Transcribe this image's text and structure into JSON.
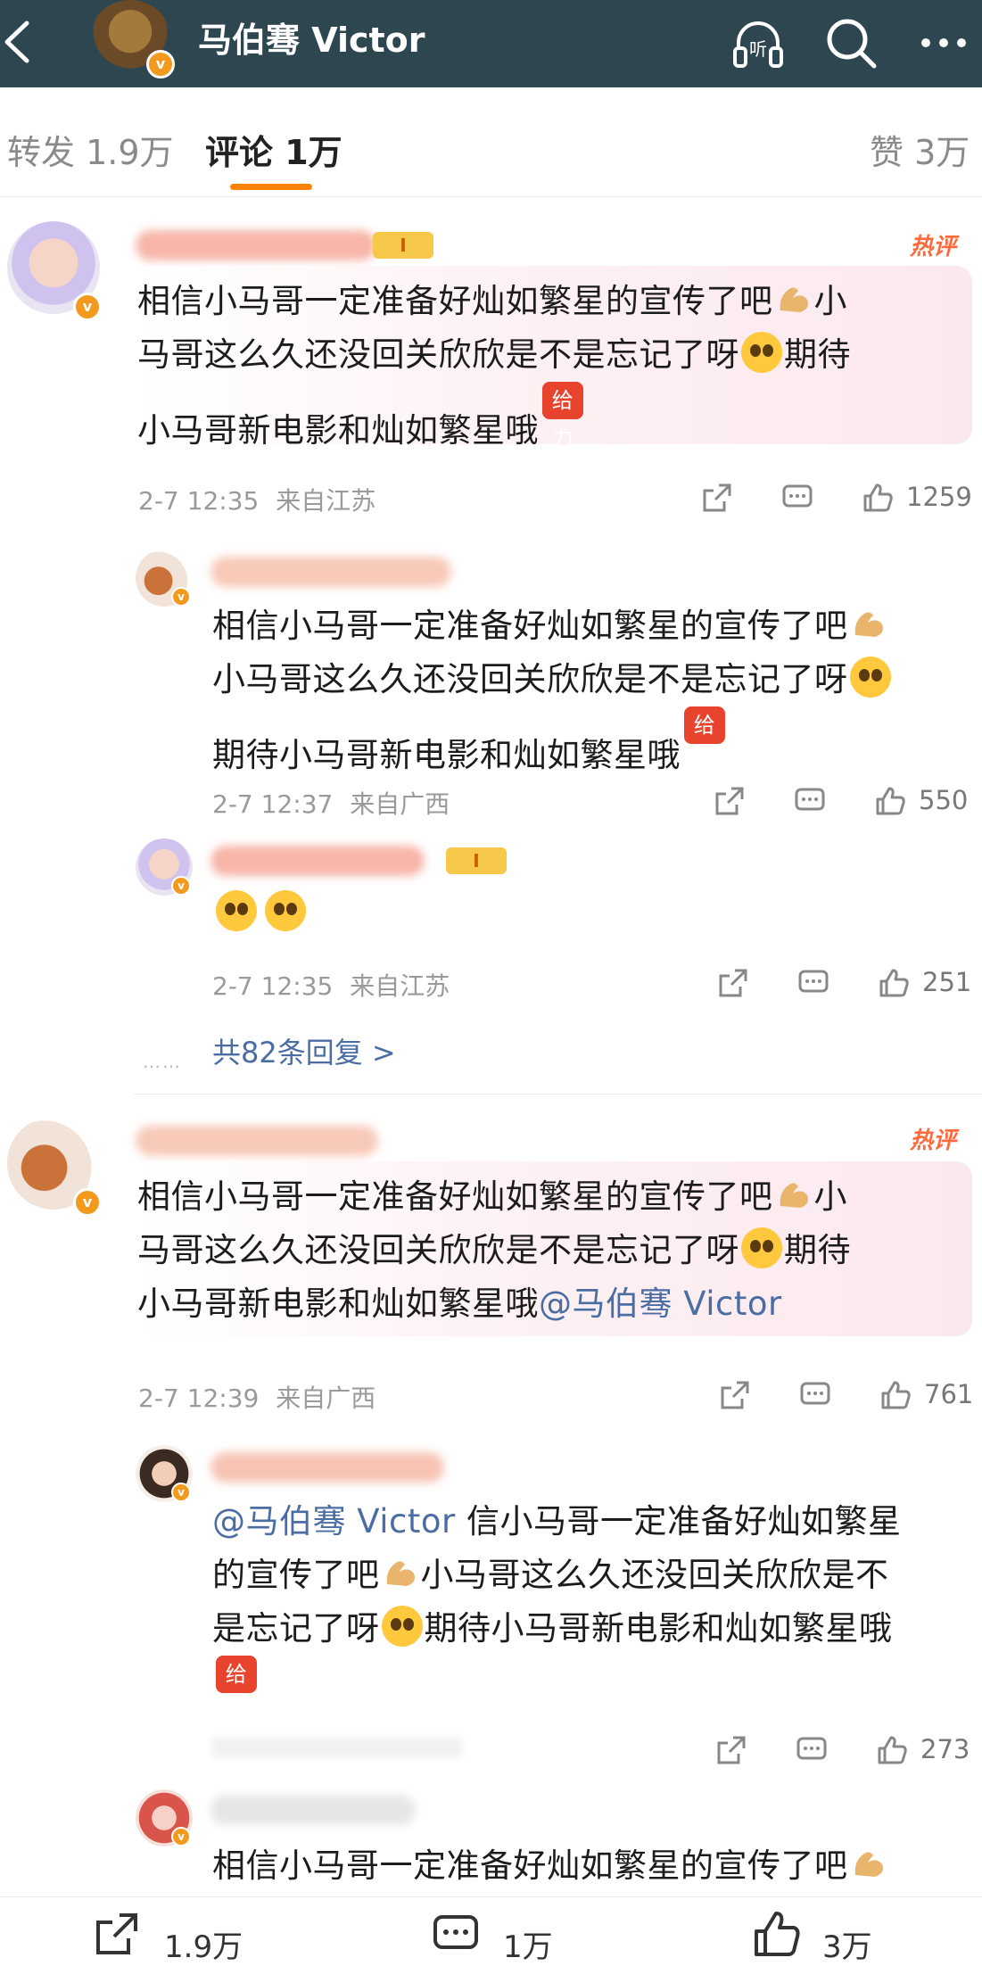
{
  "header": {
    "title": "马伯骞 Victor",
    "listen_label": "听"
  },
  "tabs": {
    "repost": "转发 1.9万",
    "comments": "评论 1万",
    "likes": "赞 3万"
  },
  "comments": [
    {
      "hot_label": "热评",
      "level": "I",
      "text": "相信小马哥一定准备好灿如繁星的宣传了吧",
      "text_b": "小",
      "text_line2": "马哥这么久还没回关欣欣是不是忘记了呀",
      "text_line2_b": "期待",
      "text_line3": "小马哥新电影和灿如繁星哦",
      "tag": "给力",
      "time": "2-7 12:35",
      "location": "来自江苏",
      "likes": "1259",
      "replies": [
        {
          "text1": "相信小马哥一定准备好灿如繁星的宣传了吧",
          "text2": "小马哥这么久还没回关欣欣是不是忘记了呀",
          "text3": "期待小马哥新电影和灿如繁星哦",
          "tag": "给力",
          "time": "2-7 12:37",
          "location": "来自广西",
          "likes": "550"
        },
        {
          "level": "I",
          "time": "2-7 12:35",
          "location": "来自江苏",
          "likes": "251"
        }
      ],
      "more_replies": "共82条回复 >"
    },
    {
      "hot_label": "热评",
      "text": "相信小马哥一定准备好灿如繁星的宣传了吧",
      "text_b": "小",
      "text_line2": "马哥这么久还没回关欣欣是不是忘记了呀",
      "text_line2_b": "期待",
      "text_line3": "小马哥新电影和灿如繁星哦",
      "mention": "@马伯骞 Victor",
      "time": "2-7 12:39",
      "location": "来自广西",
      "likes": "761",
      "replies": [
        {
          "mention": "@马伯骞 Victor",
          "text1": "信小马哥一定准备好灿如繁星",
          "text2a": "的宣传了吧",
          "text2b": "小马哥这么久还没回关欣欣是不",
          "text3a": "是忘记了呀",
          "text3b": "期待小马哥新电影和灿如繁星哦",
          "tag": "给力",
          "likes": "273"
        },
        {
          "text1": "相信小马哥一定准备好灿如繁星的宣传了吧"
        }
      ]
    }
  ],
  "bottom": {
    "repost": "1.9万",
    "comment": "1万",
    "like": "3万"
  }
}
